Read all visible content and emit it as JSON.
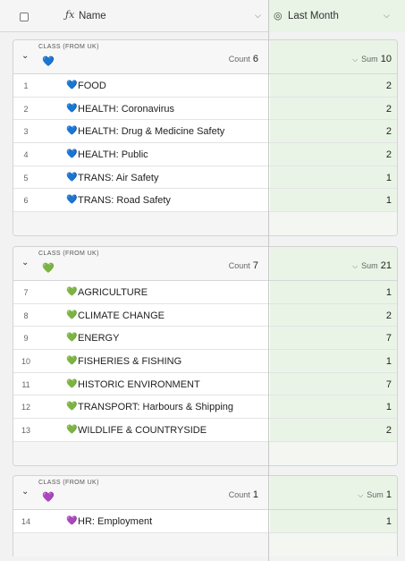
{
  "header": {
    "name_label": "Name",
    "last_month_label": "Last Month",
    "name_icon": "formula-icon",
    "last_month_icon": "rollup-icon"
  },
  "colors": {
    "blue_heart": "#4a9be0",
    "green_heart": "#5aa84f",
    "purple_heart": "#a97bd6",
    "last_month_bg": "#e9f4e6"
  },
  "groups": [
    {
      "class_label": "CLASS (FROM UK)",
      "heart": "💙",
      "count_label": "Count",
      "count": "6",
      "sum_label": "Sum",
      "sum": "10",
      "rows": [
        {
          "num": "1",
          "heart": "💙",
          "name": "FOOD",
          "value": "2"
        },
        {
          "num": "2",
          "heart": "💙",
          "name": "HEALTH: Coronavirus",
          "value": "2"
        },
        {
          "num": "3",
          "heart": "💙",
          "name": "HEALTH: Drug & Medicine Safety",
          "value": "2"
        },
        {
          "num": "4",
          "heart": "💙",
          "name": "HEALTH: Public",
          "value": "2"
        },
        {
          "num": "5",
          "heart": "💙",
          "name": "TRANS: Air Safety",
          "value": "1"
        },
        {
          "num": "6",
          "heart": "💙",
          "name": "TRANS: Road Safety",
          "value": "1"
        }
      ]
    },
    {
      "class_label": "CLASS (FROM UK)",
      "heart": "💚",
      "count_label": "Count",
      "count": "7",
      "sum_label": "Sum",
      "sum": "21",
      "rows": [
        {
          "num": "7",
          "heart": "💚",
          "name": "AGRICULTURE",
          "value": "1"
        },
        {
          "num": "8",
          "heart": "💚",
          "name": "CLIMATE CHANGE",
          "value": "2"
        },
        {
          "num": "9",
          "heart": "💚",
          "name": "ENERGY",
          "value": "7"
        },
        {
          "num": "10",
          "heart": "💚",
          "name": "FISHERIES & FISHING",
          "value": "1"
        },
        {
          "num": "11",
          "heart": "💚",
          "name": "HISTORIC ENVIRONMENT",
          "value": "7"
        },
        {
          "num": "12",
          "heart": "💚",
          "name": "TRANSPORT: Harbours & Shipping",
          "value": "1"
        },
        {
          "num": "13",
          "heart": "💚",
          "name": "WILDLIFE & COUNTRYSIDE",
          "value": "2"
        }
      ]
    },
    {
      "class_label": "CLASS (FROM UK)",
      "heart": "💜",
      "count_label": "Count",
      "count": "1",
      "sum_label": "Sum",
      "sum": "1",
      "rows": [
        {
          "num": "14",
          "heart": "💜",
          "name": "HR: Employment",
          "value": "1"
        }
      ]
    }
  ]
}
